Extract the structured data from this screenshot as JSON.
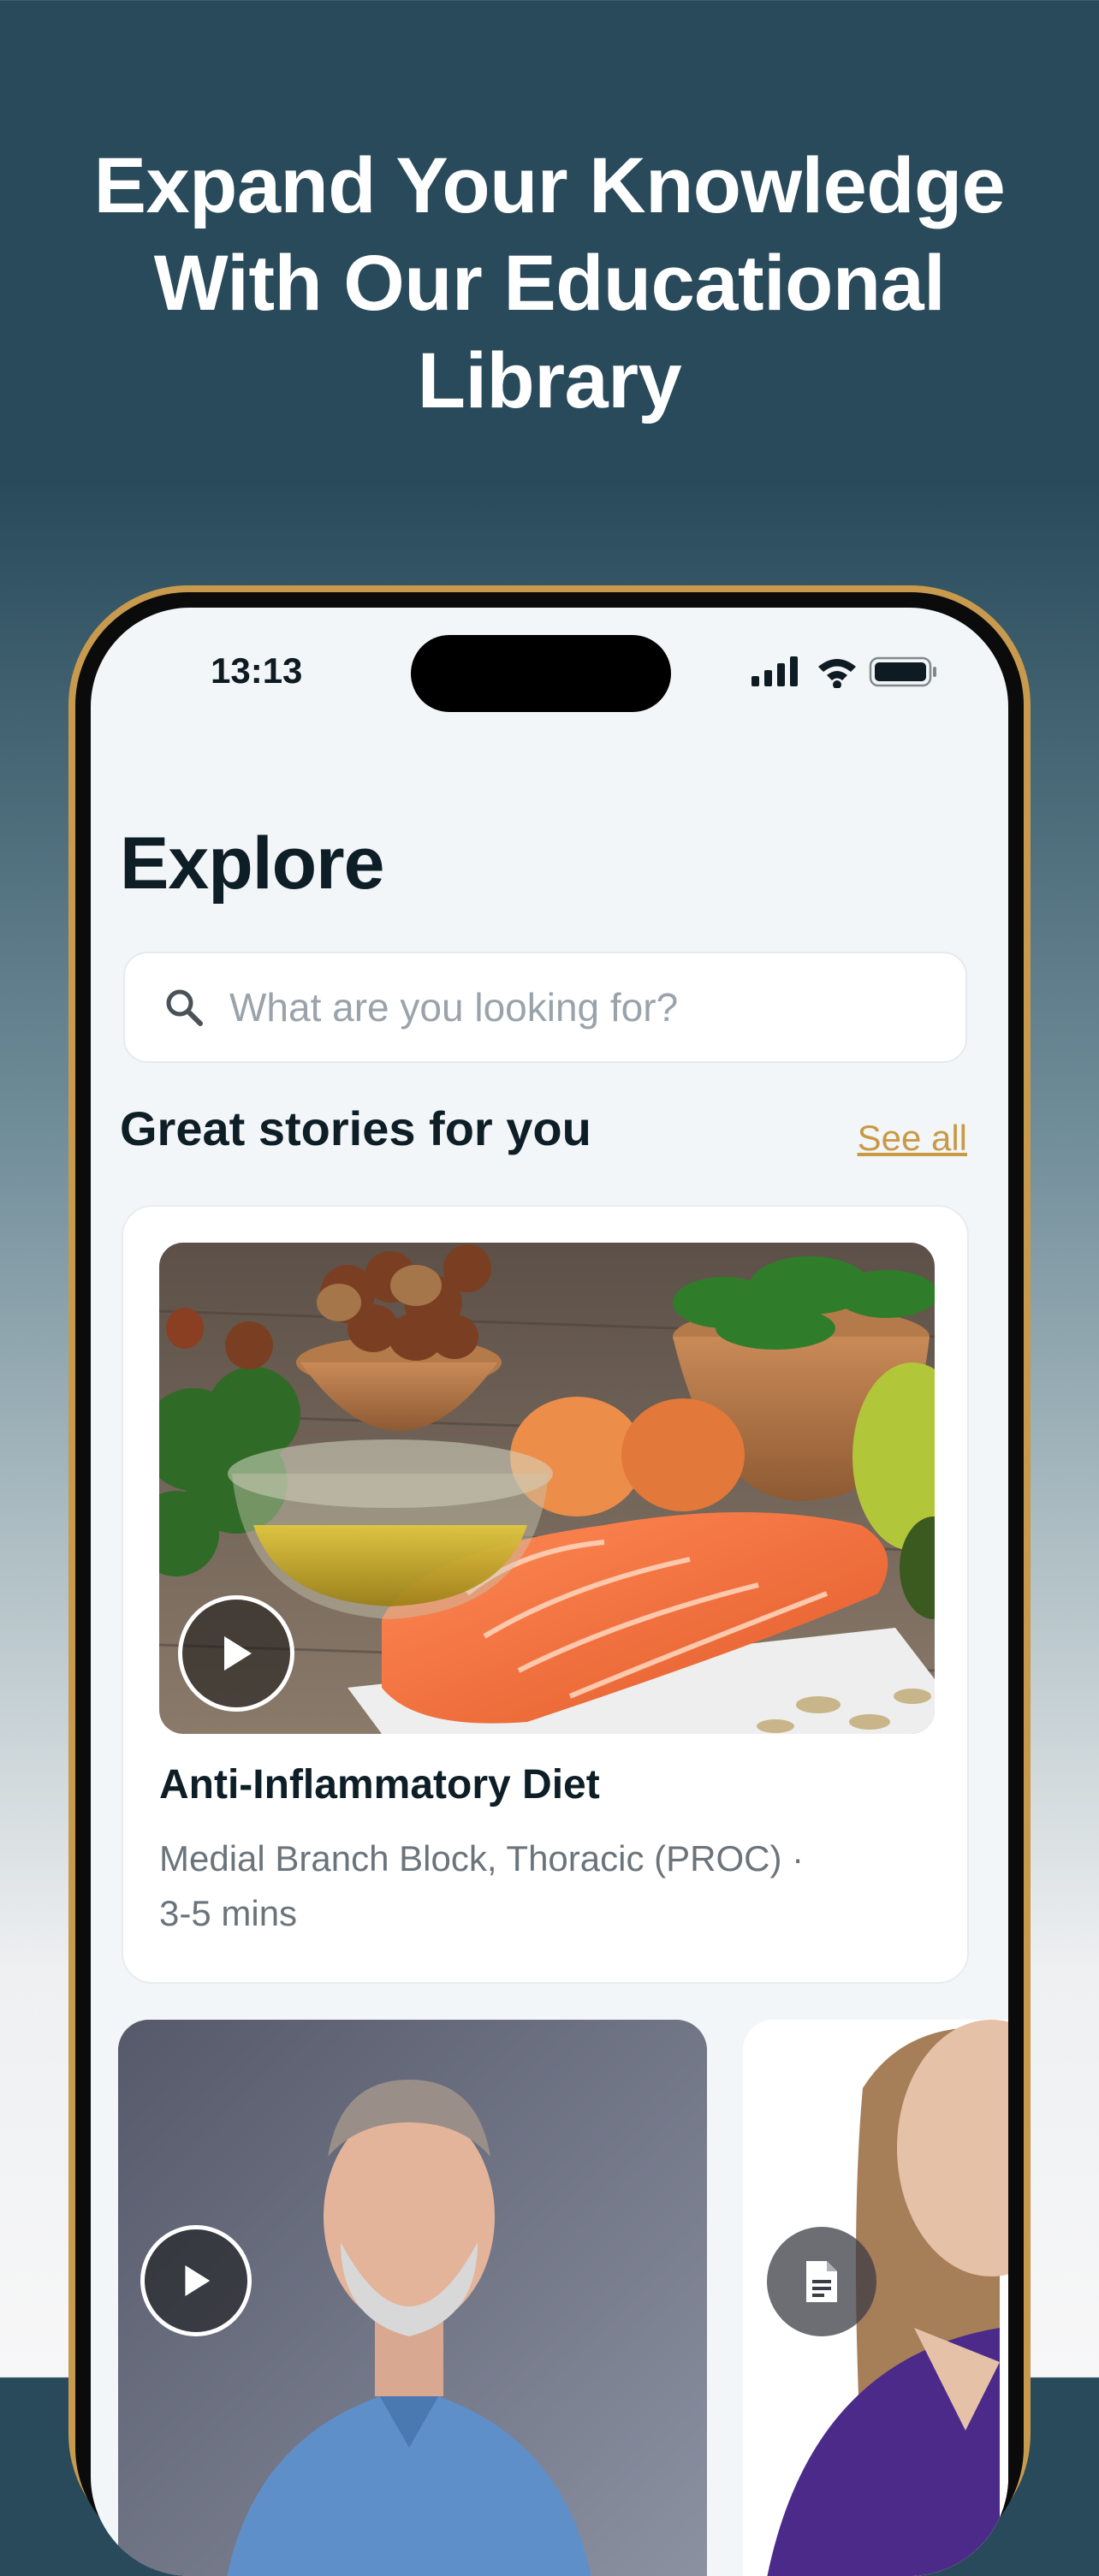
{
  "headline": {
    "line1": "Expand Your Knowledge",
    "line2": "With Our Educational",
    "line3": "Library"
  },
  "status_bar": {
    "time": "13:13",
    "icons": [
      "signal-icon",
      "wifi-icon",
      "battery-icon"
    ]
  },
  "page": {
    "title": "Explore"
  },
  "search": {
    "placeholder": "What are you looking for?",
    "value": ""
  },
  "section": {
    "title": "Great stories for you",
    "see_all": "See all"
  },
  "featured_card": {
    "title": "Anti-Inflammatory Diet",
    "meta_line1": "Medial Branch Block, Thoracic (PROC) ·",
    "meta_line2": "3-5 mins",
    "media": "video"
  },
  "carousel": [
    {
      "media": "video"
    },
    {
      "media": "document"
    }
  ],
  "colors": {
    "accent": "#c99a46",
    "header_bg": "#284a5a",
    "title_text": "#0e1e27",
    "meta_text": "#6b747b"
  }
}
